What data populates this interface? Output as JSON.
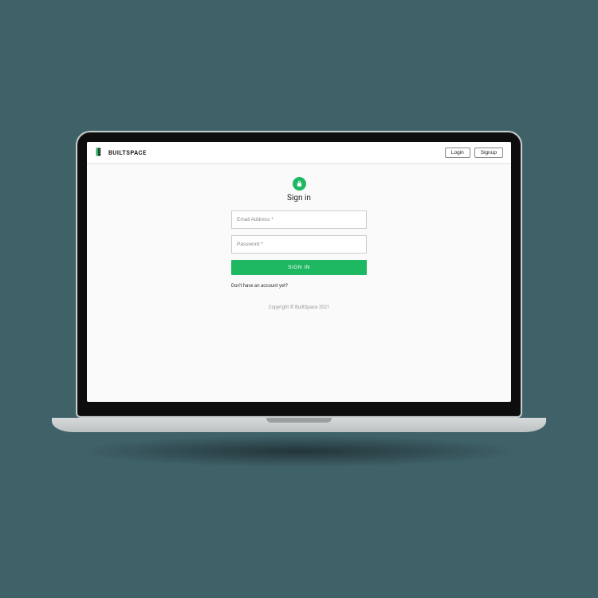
{
  "brand": {
    "name": "BUILTSPACE"
  },
  "header": {
    "login_label": "Login",
    "signup_label": "Signup"
  },
  "signin": {
    "title": "Sign in",
    "email_placeholder": "Email Address *",
    "password_placeholder": "Password *",
    "submit_label": "SIGN IN",
    "no_account_text": "Don't have an account yet?"
  },
  "footer": {
    "copyright": "Copyright © BuiltSpace 2021"
  },
  "colors": {
    "accent": "#1fb862"
  }
}
